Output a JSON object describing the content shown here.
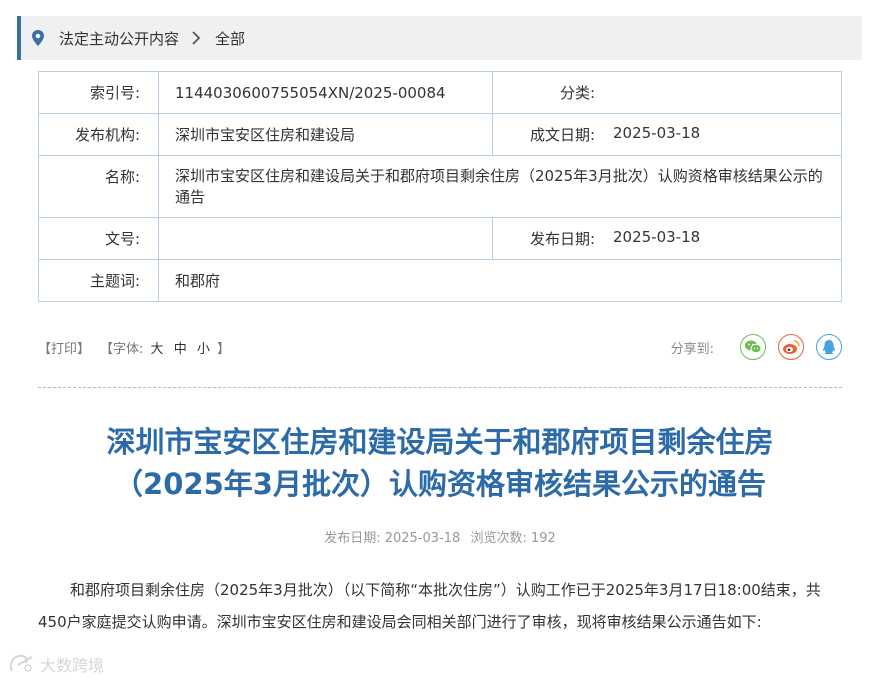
{
  "breadcrumb": {
    "section": "法定主动公开内容",
    "current": "全部"
  },
  "meta": {
    "index_label": "索引号:",
    "index_value": "1144030600755054XN/2025-00084",
    "category_label": "分类:",
    "category_value": "",
    "publisher_label": "发布机构:",
    "publisher_value": "深圳市宝安区住房和建设局",
    "created_label": "成文日期:",
    "created_value": "2025-03-18",
    "name_label": "名称:",
    "name_value": "深圳市宝安区住房和建设局关于和郡府项目剩余住房（2025年3月批次）认购资格审核结果公示的通告",
    "docno_label": "文号:",
    "docno_value": "",
    "pubdate_label": "发布日期:",
    "pubdate_value": "2025-03-18",
    "keywords_label": "主题词:",
    "keywords_value": "和郡府"
  },
  "toolbar": {
    "print": "【打印】",
    "font_prefix": "【字体:",
    "font_large": "大",
    "font_medium": "中",
    "font_small": "小",
    "font_suffix": "】",
    "share_label": "分享到:"
  },
  "article": {
    "title_line1": "深圳市宝安区住房和建设局关于和郡府项目剩余住房",
    "title_line2": "（2025年3月批次）认购资格审核结果公示的通告",
    "pub_date_label": "发布日期:",
    "pub_date": "2025-03-18",
    "views_label": "浏览次数:",
    "views": "192",
    "paragraph": "和郡府项目剩余住房（2025年3月批次）（以下简称“本批次住房”）认购工作已于2025年3月17日18:00结束，共450户家庭提交认购申请。深圳市宝安区住房和建设局会同相关部门进行了审核，现将审核结果公示通告如下:"
  },
  "watermark": {
    "text": "大数跨境"
  },
  "icons": {
    "breadcrumb": "location-pin-icon",
    "separator": "chevron-right-icon",
    "share": [
      "wechat-icon",
      "weibo-icon",
      "qq-icon"
    ]
  },
  "colors": {
    "accent": "#3a6ea5",
    "title": "#2c6aa8",
    "table_border": "#b9cfe3",
    "wechat": "#6bbd53",
    "weibo": "#e8613d",
    "qq": "#4aa2e0"
  }
}
